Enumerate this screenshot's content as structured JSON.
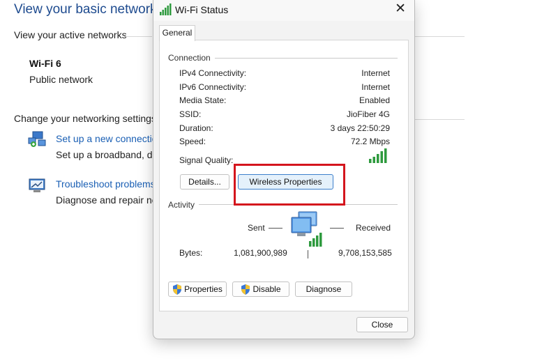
{
  "background": {
    "title": "View your basic network i",
    "active_networks_heading": "View your active networks",
    "network_name": "Wi-Fi 6",
    "network_type": "Public network",
    "change_settings_heading": "Change your networking settings",
    "setup_link": "Set up a new connectio",
    "setup_desc": "Set up a broadband, dia",
    "troubleshoot_link": "Troubleshoot problems",
    "troubleshoot_desc": "Diagnose and repair ne"
  },
  "dialog": {
    "title": "Wi-Fi Status",
    "close_glyph": "✕",
    "tab": "General",
    "connection": {
      "label": "Connection",
      "rows": [
        {
          "label": "IPv4 Connectivity:",
          "value": "Internet"
        },
        {
          "label": "IPv6 Connectivity:",
          "value": "Internet"
        },
        {
          "label": "Media State:",
          "value": "Enabled"
        },
        {
          "label": "SSID:",
          "value": "JioFiber 4G"
        },
        {
          "label": "Duration:",
          "value": "3 days 22:50:29"
        },
        {
          "label": "Speed:",
          "value": "72.2 Mbps"
        }
      ],
      "signal_label": "Signal Quality:",
      "signal_bars": 5
    },
    "buttons": {
      "details": "Details...",
      "wireless_properties": "Wireless Properties",
      "properties": "Properties",
      "disable": "Disable",
      "diagnose": "Diagnose",
      "close": "Close"
    },
    "activity": {
      "label": "Activity",
      "sent_label": "Sent",
      "received_label": "Received",
      "bytes_label": "Bytes:",
      "bytes_sent": "1,081,900,989",
      "bytes_received": "9,708,153,585"
    }
  },
  "colors": {
    "highlight": "#d4151d",
    "link": "#1a5fb4",
    "title_blue": "#1e4b8f",
    "signal_green": "#2e9a3e"
  }
}
